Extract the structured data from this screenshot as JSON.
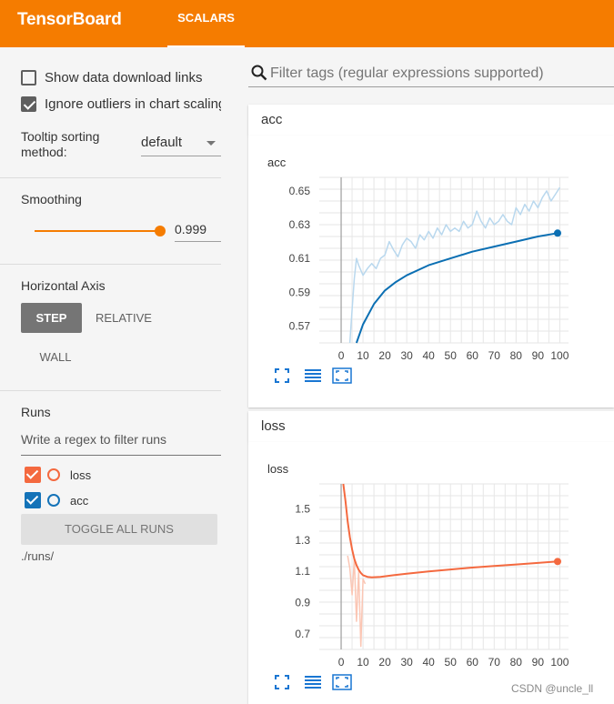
{
  "app": {
    "brand": "TensorBoard",
    "tab_scalars": "SCALARS"
  },
  "sidebar": {
    "show_download_links": {
      "label": "Show data download links",
      "checked": false
    },
    "ignore_outliers": {
      "label": "Ignore outliers in chart scaling",
      "checked": true
    },
    "tooltip_sorting": {
      "label_line1": "Tooltip sorting",
      "label_line2": "method:",
      "value": "default"
    },
    "smoothing": {
      "title": "Smoothing",
      "value": "0.999",
      "fraction": 0.999
    },
    "horizontal_axis": {
      "title": "Horizontal Axis",
      "step": "STEP",
      "relative": "RELATIVE",
      "wall": "WALL",
      "selected": "STEP"
    },
    "runs": {
      "title": "Runs",
      "filter_placeholder": "Write a regex to filter runs",
      "items": [
        {
          "name": "loss",
          "color": "#f4693f",
          "checked": true
        },
        {
          "name": "acc",
          "color": "#1473b8",
          "checked": true
        }
      ],
      "toggle_all": "TOGGLE ALL RUNS",
      "path": "./runs/"
    }
  },
  "main": {
    "search_placeholder": "Filter tags (regular expressions supported)",
    "groups": [
      {
        "header": "acc",
        "card_title": "acc"
      },
      {
        "header": "loss",
        "card_title": "loss"
      }
    ]
  },
  "chart_data": [
    {
      "type": "line",
      "title": "acc",
      "x_ticks": [
        "0",
        "10",
        "20",
        "30",
        "40",
        "50",
        "60",
        "70",
        "80",
        "90",
        "100"
      ],
      "y_ticks": [
        "0.57",
        "0.59",
        "0.61",
        "0.63",
        "0.65"
      ],
      "xlim": [
        -10,
        104
      ],
      "ylim": [
        0.56,
        0.658
      ],
      "grid": true,
      "series": [
        {
          "role": "smoothed",
          "color": "#0b6fb3",
          "x": [
            7,
            10,
            15,
            20,
            25,
            30,
            40,
            50,
            60,
            70,
            80,
            90,
            99
          ],
          "y": [
            0.56,
            0.571,
            0.583,
            0.591,
            0.596,
            0.6,
            0.606,
            0.61,
            0.614,
            0.617,
            0.62,
            0.623,
            0.625
          ]
        },
        {
          "role": "raw",
          "color": "#b9d8ee",
          "x": [
            4,
            5,
            6,
            7,
            8,
            10,
            12,
            14,
            16,
            18,
            20,
            22,
            24,
            26,
            28,
            30,
            32,
            34,
            36,
            38,
            40,
            42,
            44,
            46,
            48,
            50,
            52,
            54,
            56,
            58,
            60,
            62,
            64,
            66,
            68,
            70,
            72,
            74,
            76,
            78,
            80,
            82,
            84,
            86,
            88,
            90,
            92,
            94,
            96,
            98,
            100
          ],
          "y": [
            0.555,
            0.58,
            0.598,
            0.61,
            0.606,
            0.6,
            0.604,
            0.607,
            0.604,
            0.61,
            0.612,
            0.62,
            0.615,
            0.611,
            0.618,
            0.622,
            0.62,
            0.616,
            0.624,
            0.621,
            0.626,
            0.622,
            0.628,
            0.624,
            0.63,
            0.626,
            0.628,
            0.626,
            0.632,
            0.628,
            0.63,
            0.638,
            0.632,
            0.628,
            0.634,
            0.63,
            0.632,
            0.636,
            0.632,
            0.63,
            0.64,
            0.636,
            0.642,
            0.638,
            0.644,
            0.64,
            0.646,
            0.65,
            0.644,
            0.648,
            0.652
          ]
        }
      ]
    },
    {
      "type": "line",
      "title": "loss",
      "x_ticks": [
        "0",
        "10",
        "20",
        "30",
        "40",
        "50",
        "60",
        "70",
        "80",
        "90",
        "100"
      ],
      "y_ticks": [
        "0.7",
        "0.9",
        "1.1",
        "1.3",
        "1.5"
      ],
      "xlim": [
        -10,
        104
      ],
      "ylim": [
        0.6,
        1.66
      ],
      "grid": true,
      "series": [
        {
          "role": "smoothed",
          "color": "#f4693f",
          "x": [
            1,
            2,
            3,
            4,
            5,
            6,
            7,
            8,
            9,
            10,
            12,
            14,
            16,
            18,
            20,
            24,
            30,
            40,
            50,
            60,
            70,
            80,
            90,
            99
          ],
          "y": [
            1.66,
            1.55,
            1.42,
            1.32,
            1.24,
            1.18,
            1.14,
            1.11,
            1.09,
            1.075,
            1.065,
            1.062,
            1.063,
            1.065,
            1.068,
            1.075,
            1.085,
            1.1,
            1.112,
            1.124,
            1.134,
            1.144,
            1.154,
            1.163
          ]
        },
        {
          "role": "raw",
          "color": "#fbc6b4",
          "x": [
            3,
            4,
            5,
            6,
            7,
            8,
            9,
            10,
            11
          ],
          "y": [
            1.2,
            1.12,
            0.95,
            1.18,
            0.78,
            1.1,
            0.62,
            1.05,
            1.02
          ]
        }
      ]
    }
  ],
  "watermark": "CSDN @uncle_ll"
}
